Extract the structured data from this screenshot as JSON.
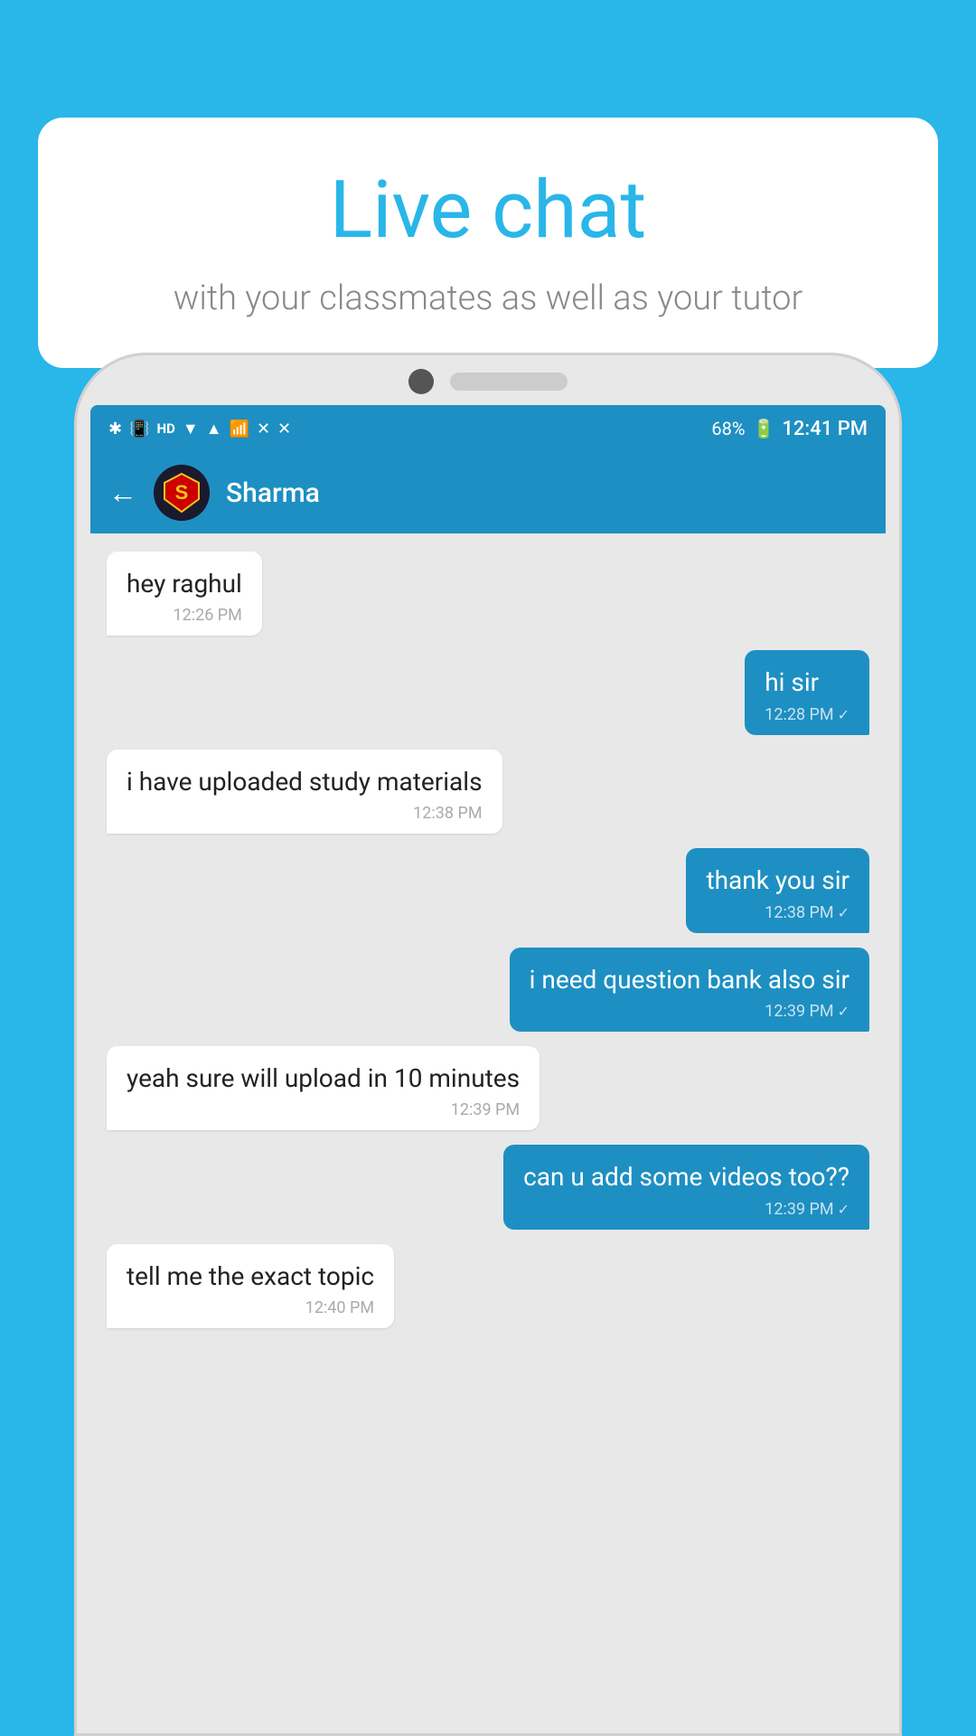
{
  "page": {
    "background_color": "#29b6e8"
  },
  "bubble": {
    "title": "Live chat",
    "subtitle": "with your classmates as well as your tutor"
  },
  "status_bar": {
    "time": "12:41 PM",
    "battery": "68%",
    "icons": [
      "bluetooth",
      "signal",
      "hd",
      "wifi",
      "network",
      "x1",
      "x2"
    ]
  },
  "chat_header": {
    "contact_name": "Sharma",
    "back_label": "←"
  },
  "messages": [
    {
      "id": 1,
      "type": "received",
      "text": "hey raghul",
      "time": "12:26 PM",
      "check": false
    },
    {
      "id": 2,
      "type": "sent",
      "text": "hi sir",
      "time": "12:28 PM",
      "check": true
    },
    {
      "id": 3,
      "type": "received",
      "text": "i have uploaded study materials",
      "time": "12:38 PM",
      "check": false
    },
    {
      "id": 4,
      "type": "sent",
      "text": "thank you sir",
      "time": "12:38 PM",
      "check": true
    },
    {
      "id": 5,
      "type": "sent",
      "text": "i need question bank also sir",
      "time": "12:39 PM",
      "check": true
    },
    {
      "id": 6,
      "type": "received",
      "text": "yeah sure will upload in 10 minutes",
      "time": "12:39 PM",
      "check": false
    },
    {
      "id": 7,
      "type": "sent",
      "text": "can u add some videos too??",
      "time": "12:39 PM",
      "check": true
    },
    {
      "id": 8,
      "type": "received",
      "text": "tell me the exact topic",
      "time": "12:40 PM",
      "check": false
    }
  ]
}
